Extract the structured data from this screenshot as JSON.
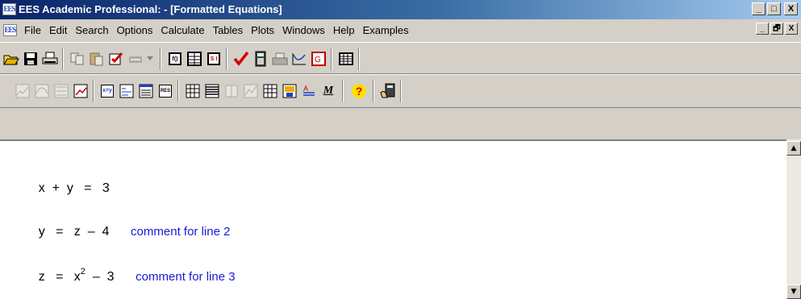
{
  "window": {
    "title": "EES Academic Professional:  - [Formatted Equations]",
    "icon_text_a": "E",
    "icon_text_b": "ES",
    "controls": [
      "_",
      "□",
      "X"
    ],
    "mdi_controls": [
      "_",
      "🗗",
      "X"
    ]
  },
  "menu": {
    "items": [
      "File",
      "Edit",
      "Search",
      "Options",
      "Calculate",
      "Tables",
      "Plots",
      "Windows",
      "Help",
      "Examples"
    ]
  },
  "toolbar1": {
    "icons": [
      "open-icon",
      "save-icon",
      "print-icon",
      "copy-icon",
      "paste-icon",
      "check-window-icon",
      "dropdown-icon",
      "lookup-icon",
      "table-icon",
      "si-units-icon",
      "check-mark-icon",
      "calculator-icon",
      "printer-table-icon",
      "plot-icon",
      "graph-icon",
      "table-grid-icon"
    ],
    "si_label": "S I"
  },
  "toolbar2": {
    "icons": [
      "plot1-icon",
      "plot2-icon",
      "plot3-icon",
      "plot-edit-icon",
      "equation-window-icon",
      "formatted-equation-icon",
      "solution-icon",
      "residuals-icon",
      "parametric-table-icon",
      "lookup-table-icon",
      "arrays-icon",
      "plot-window-icon",
      "integral-table-icon",
      "diagram-icon",
      "text-format-icon",
      "macro-icon",
      "help-icon",
      "calculator-hand-icon"
    ],
    "xy_label": "x=y",
    "res_label": "RES",
    "macro_label": "M",
    "help_label": "?"
  },
  "equations": [
    {
      "expr": "x  +  y   =   3",
      "comment": ""
    },
    {
      "expr": "y   =   z  –  4",
      "comment": "comment for line 2"
    },
    {
      "lhs": "z   =   x",
      "exp": "2",
      "rhs": "  –  3",
      "comment": "comment for line 3"
    }
  ],
  "colors": {
    "title_start": "#0a246a",
    "title_end": "#a6caf0",
    "chrome": "#d4d0c8",
    "comment": "#1a1ad6",
    "check": "#d40000"
  }
}
